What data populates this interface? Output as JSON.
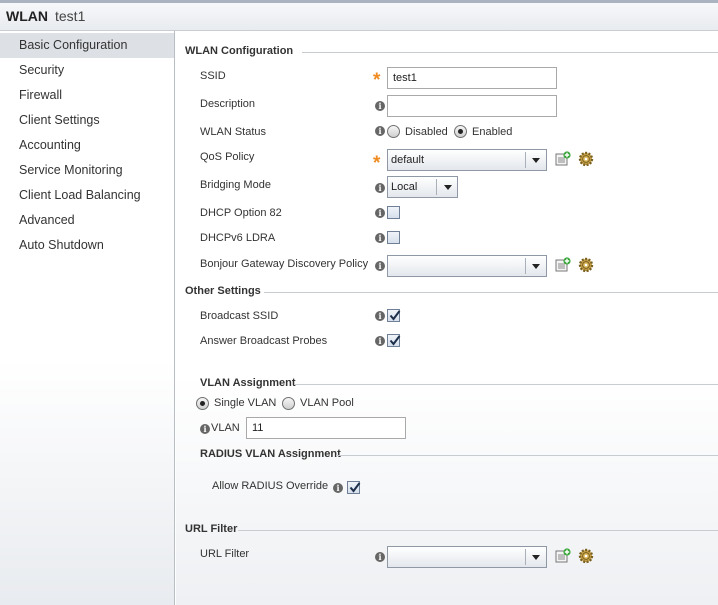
{
  "header": {
    "title": "WLAN",
    "name": "test1"
  },
  "sidebar": {
    "items": [
      {
        "label": "Basic Configuration"
      },
      {
        "label": "Security"
      },
      {
        "label": "Firewall"
      },
      {
        "label": "Client Settings"
      },
      {
        "label": "Accounting"
      },
      {
        "label": "Service Monitoring"
      },
      {
        "label": "Client Load Balancing"
      },
      {
        "label": "Advanced"
      },
      {
        "label": "Auto Shutdown"
      }
    ],
    "active_index": 0
  },
  "wlan_config": {
    "title": "WLAN Configuration",
    "ssid": {
      "label": "SSID",
      "value": "test1",
      "required": true
    },
    "description": {
      "label": "Description",
      "value": ""
    },
    "status": {
      "label": "WLAN Status",
      "options": [
        "Disabled",
        "Enabled"
      ],
      "selected": "Enabled"
    },
    "qos": {
      "label": "QoS Policy",
      "value": "default",
      "required": true
    },
    "bridging": {
      "label": "Bridging Mode",
      "value": "Local"
    },
    "dhcp82": {
      "label": "DHCP Option 82",
      "checked": false
    },
    "dhcpv6": {
      "label": "DHCPv6 LDRA",
      "checked": false
    },
    "bonjour": {
      "label": "Bonjour Gateway Discovery Policy",
      "value": ""
    }
  },
  "other_settings": {
    "title": "Other Settings",
    "broadcast_ssid": {
      "label": "Broadcast SSID",
      "checked": true
    },
    "answer_probes": {
      "label": "Answer Broadcast Probes",
      "checked": true
    }
  },
  "vlan_assignment": {
    "title": "VLAN Assignment",
    "options": [
      "Single VLAN",
      "VLAN Pool"
    ],
    "selected": "Single VLAN",
    "vlan_label": "VLAN",
    "vlan_value": "11"
  },
  "radius_vlan": {
    "title": "RADIUS VLAN Assignment",
    "allow_override": {
      "label": "Allow RADIUS Override",
      "checked": true
    }
  },
  "url_filter": {
    "title": "URL Filter",
    "label": "URL Filter",
    "value": ""
  },
  "colors": {
    "required_star": "#ef8b1f",
    "active_item_bg": "#dde1e6"
  },
  "icons": {
    "info": "info-icon",
    "new": "create-new-icon",
    "edit": "configure-gear-icon"
  }
}
